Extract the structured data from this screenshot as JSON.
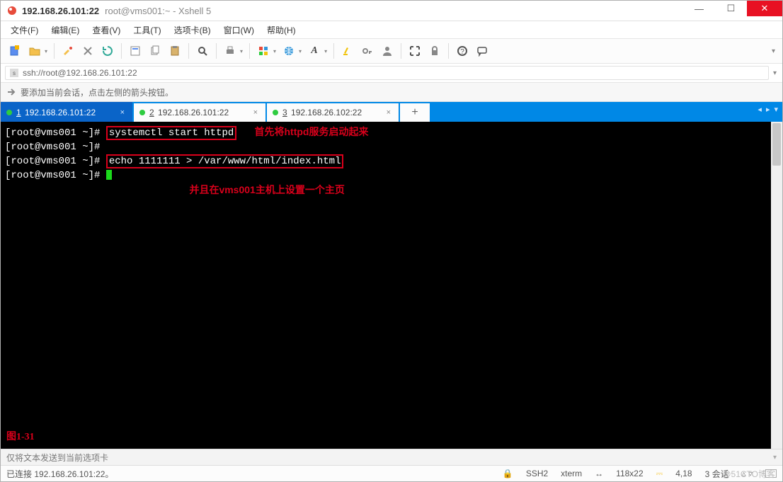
{
  "titlebar": {
    "bold": "192.168.26.101:22",
    "rest": "root@vms001:~ - Xshell 5"
  },
  "menu": {
    "file": "文件(F)",
    "edit": "编辑(E)",
    "view": "查看(V)",
    "tools": "工具(T)",
    "tabs": "选项卡(B)",
    "window": "窗口(W)",
    "help": "帮助(H)"
  },
  "toolbar_icons": {
    "new": "new-session-icon",
    "open": "open-icon",
    "connect": "connect-icon",
    "disconnect": "disconnect-icon",
    "props": "properties-icon",
    "copy": "copy-icon",
    "paste": "paste-icon",
    "find": "find-icon",
    "print": "print-icon",
    "color": "color-icon",
    "globe": "globe-icon",
    "font": "font-icon",
    "hl": "highlight-icon",
    "key": "key-icon",
    "user": "user-icon",
    "fullscreen": "fullscreen-icon",
    "lock": "lock-icon",
    "help": "help-icon",
    "feedback": "feedback-icon"
  },
  "address": {
    "url": "ssh://root@192.168.26.101:22"
  },
  "tip": {
    "text": "要添加当前会话，点击左侧的箭头按钮。"
  },
  "tabs": {
    "t1": {
      "num": "1",
      "label": "192.168.26.101:22"
    },
    "t2": {
      "num": "2",
      "label": "192.168.26.101:22"
    },
    "t3": {
      "num": "3",
      "label": "192.168.26.102:22"
    },
    "add": "+"
  },
  "terminal": {
    "prompt": "[root@vms001 ~]#",
    "cmd1": "systemctl start httpd",
    "ann1": "首先将httpd服务启动起来",
    "cmd2": "echo 1111111 > /var/www/html/index.html",
    "ann2": "并且在vms001主机上设置一个主页",
    "figure": "图1-31"
  },
  "status": {
    "hint": "仅将文本发送到当前选项卡",
    "connected": "已连接 192.168.26.101:22。",
    "proto": "SSH2",
    "term": "xterm",
    "size": "118x22",
    "pos": "4,18",
    "sessions": "3 会话"
  },
  "watermark": "@51CTO博客"
}
